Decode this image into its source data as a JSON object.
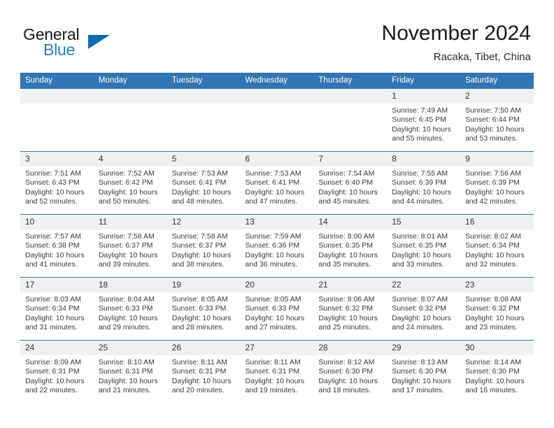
{
  "brand": {
    "name_part1": "General",
    "name_part2": "Blue",
    "triangle_color": "#0d6cb0",
    "blue_text_color": "#1e7fc4"
  },
  "header": {
    "title": "November 2024",
    "subtitle": "Racaka, Tibet, China"
  },
  "theme": {
    "header_blue": "#3175b5",
    "daynum_background": "#f0f0f0",
    "cell_background": "#ffffff",
    "text_color": "#3a3a3a"
  },
  "weekdays": [
    "Sunday",
    "Monday",
    "Tuesday",
    "Wednesday",
    "Thursday",
    "Friday",
    "Saturday"
  ],
  "labels": {
    "sunrise_prefix": "Sunrise:",
    "sunset_prefix": "Sunset:",
    "daylight_prefix": "Daylight:"
  },
  "weeks": [
    [
      {
        "day": "",
        "blank": true
      },
      {
        "day": "",
        "blank": true
      },
      {
        "day": "",
        "blank": true
      },
      {
        "day": "",
        "blank": true
      },
      {
        "day": "",
        "blank": true
      },
      {
        "day": "1",
        "sunrise": "Sunrise: 7:49 AM",
        "sunset": "Sunset: 6:45 PM",
        "daylight_l1": "Daylight: 10 hours",
        "daylight_l2": "and 55 minutes."
      },
      {
        "day": "2",
        "sunrise": "Sunrise: 7:50 AM",
        "sunset": "Sunset: 6:44 PM",
        "daylight_l1": "Daylight: 10 hours",
        "daylight_l2": "and 53 minutes."
      }
    ],
    [
      {
        "day": "3",
        "sunrise": "Sunrise: 7:51 AM",
        "sunset": "Sunset: 6:43 PM",
        "daylight_l1": "Daylight: 10 hours",
        "daylight_l2": "and 52 minutes."
      },
      {
        "day": "4",
        "sunrise": "Sunrise: 7:52 AM",
        "sunset": "Sunset: 6:42 PM",
        "daylight_l1": "Daylight: 10 hours",
        "daylight_l2": "and 50 minutes."
      },
      {
        "day": "5",
        "sunrise": "Sunrise: 7:53 AM",
        "sunset": "Sunset: 6:41 PM",
        "daylight_l1": "Daylight: 10 hours",
        "daylight_l2": "and 48 minutes."
      },
      {
        "day": "6",
        "sunrise": "Sunrise: 7:53 AM",
        "sunset": "Sunset: 6:41 PM",
        "daylight_l1": "Daylight: 10 hours",
        "daylight_l2": "and 47 minutes."
      },
      {
        "day": "7",
        "sunrise": "Sunrise: 7:54 AM",
        "sunset": "Sunset: 6:40 PM",
        "daylight_l1": "Daylight: 10 hours",
        "daylight_l2": "and 45 minutes."
      },
      {
        "day": "8",
        "sunrise": "Sunrise: 7:55 AM",
        "sunset": "Sunset: 6:39 PM",
        "daylight_l1": "Daylight: 10 hours",
        "daylight_l2": "and 44 minutes."
      },
      {
        "day": "9",
        "sunrise": "Sunrise: 7:56 AM",
        "sunset": "Sunset: 6:39 PM",
        "daylight_l1": "Daylight: 10 hours",
        "daylight_l2": "and 42 minutes."
      }
    ],
    [
      {
        "day": "10",
        "sunrise": "Sunrise: 7:57 AM",
        "sunset": "Sunset: 6:38 PM",
        "daylight_l1": "Daylight: 10 hours",
        "daylight_l2": "and 41 minutes."
      },
      {
        "day": "11",
        "sunrise": "Sunrise: 7:58 AM",
        "sunset": "Sunset: 6:37 PM",
        "daylight_l1": "Daylight: 10 hours",
        "daylight_l2": "and 39 minutes."
      },
      {
        "day": "12",
        "sunrise": "Sunrise: 7:58 AM",
        "sunset": "Sunset: 6:37 PM",
        "daylight_l1": "Daylight: 10 hours",
        "daylight_l2": "and 38 minutes."
      },
      {
        "day": "13",
        "sunrise": "Sunrise: 7:59 AM",
        "sunset": "Sunset: 6:36 PM",
        "daylight_l1": "Daylight: 10 hours",
        "daylight_l2": "and 36 minutes."
      },
      {
        "day": "14",
        "sunrise": "Sunrise: 8:00 AM",
        "sunset": "Sunset: 6:35 PM",
        "daylight_l1": "Daylight: 10 hours",
        "daylight_l2": "and 35 minutes."
      },
      {
        "day": "15",
        "sunrise": "Sunrise: 8:01 AM",
        "sunset": "Sunset: 6:35 PM",
        "daylight_l1": "Daylight: 10 hours",
        "daylight_l2": "and 33 minutes."
      },
      {
        "day": "16",
        "sunrise": "Sunrise: 8:02 AM",
        "sunset": "Sunset: 6:34 PM",
        "daylight_l1": "Daylight: 10 hours",
        "daylight_l2": "and 32 minutes."
      }
    ],
    [
      {
        "day": "17",
        "sunrise": "Sunrise: 8:03 AM",
        "sunset": "Sunset: 6:34 PM",
        "daylight_l1": "Daylight: 10 hours",
        "daylight_l2": "and 31 minutes."
      },
      {
        "day": "18",
        "sunrise": "Sunrise: 8:04 AM",
        "sunset": "Sunset: 6:33 PM",
        "daylight_l1": "Daylight: 10 hours",
        "daylight_l2": "and 29 minutes."
      },
      {
        "day": "19",
        "sunrise": "Sunrise: 8:05 AM",
        "sunset": "Sunset: 6:33 PM",
        "daylight_l1": "Daylight: 10 hours",
        "daylight_l2": "and 28 minutes."
      },
      {
        "day": "20",
        "sunrise": "Sunrise: 8:05 AM",
        "sunset": "Sunset: 6:33 PM",
        "daylight_l1": "Daylight: 10 hours",
        "daylight_l2": "and 27 minutes."
      },
      {
        "day": "21",
        "sunrise": "Sunrise: 8:06 AM",
        "sunset": "Sunset: 6:32 PM",
        "daylight_l1": "Daylight: 10 hours",
        "daylight_l2": "and 25 minutes."
      },
      {
        "day": "22",
        "sunrise": "Sunrise: 8:07 AM",
        "sunset": "Sunset: 6:32 PM",
        "daylight_l1": "Daylight: 10 hours",
        "daylight_l2": "and 24 minutes."
      },
      {
        "day": "23",
        "sunrise": "Sunrise: 8:08 AM",
        "sunset": "Sunset: 6:32 PM",
        "daylight_l1": "Daylight: 10 hours",
        "daylight_l2": "and 23 minutes."
      }
    ],
    [
      {
        "day": "24",
        "sunrise": "Sunrise: 8:09 AM",
        "sunset": "Sunset: 6:31 PM",
        "daylight_l1": "Daylight: 10 hours",
        "daylight_l2": "and 22 minutes."
      },
      {
        "day": "25",
        "sunrise": "Sunrise: 8:10 AM",
        "sunset": "Sunset: 6:31 PM",
        "daylight_l1": "Daylight: 10 hours",
        "daylight_l2": "and 21 minutes."
      },
      {
        "day": "26",
        "sunrise": "Sunrise: 8:11 AM",
        "sunset": "Sunset: 6:31 PM",
        "daylight_l1": "Daylight: 10 hours",
        "daylight_l2": "and 20 minutes."
      },
      {
        "day": "27",
        "sunrise": "Sunrise: 8:11 AM",
        "sunset": "Sunset: 6:31 PM",
        "daylight_l1": "Daylight: 10 hours",
        "daylight_l2": "and 19 minutes."
      },
      {
        "day": "28",
        "sunrise": "Sunrise: 8:12 AM",
        "sunset": "Sunset: 6:30 PM",
        "daylight_l1": "Daylight: 10 hours",
        "daylight_l2": "and 18 minutes."
      },
      {
        "day": "29",
        "sunrise": "Sunrise: 8:13 AM",
        "sunset": "Sunset: 6:30 PM",
        "daylight_l1": "Daylight: 10 hours",
        "daylight_l2": "and 17 minutes."
      },
      {
        "day": "30",
        "sunrise": "Sunrise: 8:14 AM",
        "sunset": "Sunset: 6:30 PM",
        "daylight_l1": "Daylight: 10 hours",
        "daylight_l2": "and 16 minutes."
      }
    ]
  ]
}
